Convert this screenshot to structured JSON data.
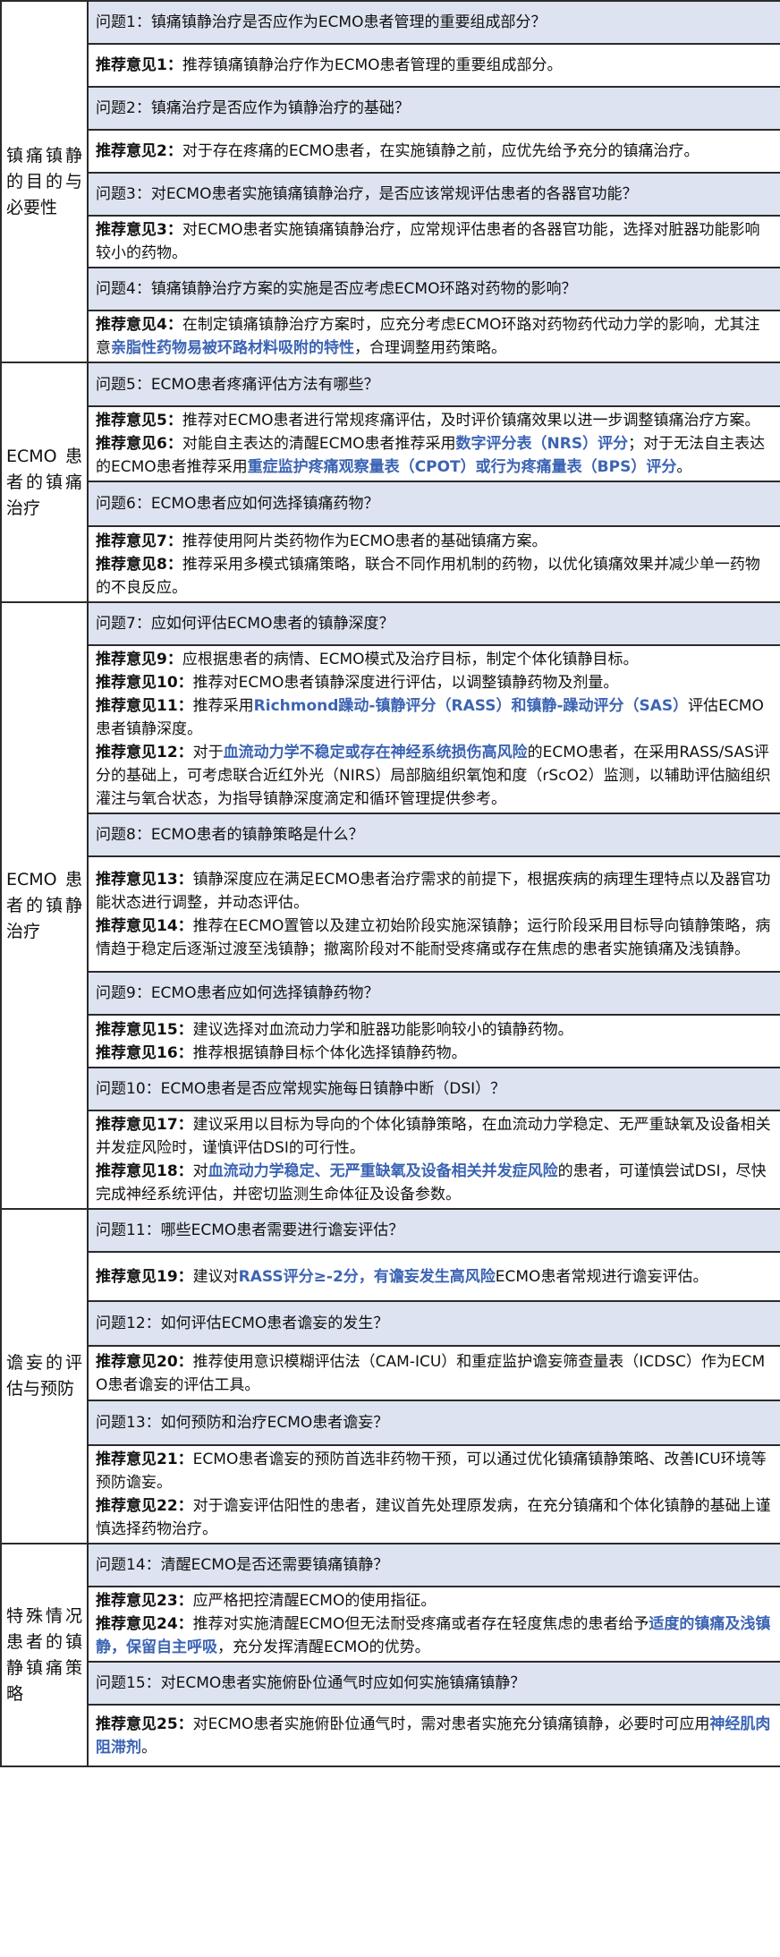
{
  "sections": [
    {
      "category": "镇痛镇静的目的与必要性",
      "qas": [
        {
          "question": "问题1：镇痛镇静治疗是否应作为ECMO患者管理的重要组成部分？",
          "recs": [
            {
              "label": "推荐意见1：",
              "parts": [
                {
                  "t": "推荐镇痛镇静治疗作为ECMO患者管理的重要组成部分。"
                }
              ]
            }
          ]
        },
        {
          "question": "问题2：镇痛治疗是否应作为镇静治疗的基础？",
          "recs": [
            {
              "label": "推荐意见2：",
              "parts": [
                {
                  "t": "对于存在疼痛的ECMO患者，在实施镇静之前，应优先给予充分的镇痛治疗。"
                }
              ]
            }
          ]
        },
        {
          "question": "问题3：对ECMO患者实施镇痛镇静治疗，是否应该常规评估患者的各器官功能？",
          "recs": [
            {
              "label": "推荐意见3：",
              "parts": [
                {
                  "t": "对ECMO患者实施镇痛镇静治疗，应常规评估患者的各器官功能，选择对脏器功能影响较小的药物。"
                }
              ]
            }
          ]
        },
        {
          "question": "问题4：镇痛镇静治疗方案的实施是否应考虑ECMO环路对药物的影响？",
          "recs": [
            {
              "label": "推荐意见4：",
              "parts": [
                {
                  "t": "在制定镇痛镇静治疗方案时，应充分考虑ECMO环路对药物药代动力学的影响，尤其注意"
                },
                {
                  "t": "亲脂性药物易被环路材料吸附的特性",
                  "hl": true
                },
                {
                  "t": "，合理调整用药策略。"
                }
              ]
            }
          ]
        }
      ]
    },
    {
      "category": "ECMO患者的镇痛治疗",
      "qas": [
        {
          "question": "问题5：ECMO患者疼痛评估方法有哪些？",
          "recs": [
            {
              "label": "推荐意见5：",
              "parts": [
                {
                  "t": "推荐对ECMO患者进行常规疼痛评估，及时评价镇痛效果以进一步调整镇痛治疗方案。"
                }
              ]
            },
            {
              "label": "推荐意见6：",
              "parts": [
                {
                  "t": "对能自主表达的清醒ECMO患者推荐采用"
                },
                {
                  "t": "数字评分表（NRS）评分",
                  "hl": true
                },
                {
                  "t": "；对于无法自主表达的ECMO患者推荐采用"
                },
                {
                  "t": "重症监护疼痛观察量表（CPOT）或行为疼痛量表（BPS）评分",
                  "hl": true
                },
                {
                  "t": "。"
                }
              ]
            }
          ]
        },
        {
          "question": "问题6：ECMO患者应如何选择镇痛药物？",
          "recs": [
            {
              "label": "推荐意见7：",
              "parts": [
                {
                  "t": "推荐使用阿片类药物作为ECMO患者的基础镇痛方案。"
                }
              ]
            },
            {
              "label": "推荐意见8：",
              "parts": [
                {
                  "t": "推荐采用多模式镇痛策略，联合不同作用机制的药物，以优化镇痛效果并减少单一药物的不良反应。"
                }
              ]
            }
          ]
        }
      ]
    },
    {
      "category": "ECMO患者的镇静治疗",
      "qas": [
        {
          "question": "问题7：应如何评估ECMO患者的镇静深度？",
          "recs": [
            {
              "label": "推荐意见9：",
              "parts": [
                {
                  "t": "应根据患者的病情、ECMO模式及治疗目标，制定个体化镇静目标。"
                }
              ]
            },
            {
              "label": "推荐意见10：",
              "parts": [
                {
                  "t": "推荐对ECMO患者镇静深度进行评估，以调整镇静药物及剂量。"
                }
              ]
            },
            {
              "label": "推荐意见11：",
              "parts": [
                {
                  "t": "推荐采用"
                },
                {
                  "t": "Richmond躁动-镇静评分（RASS）和镇静-躁动评分（SAS）",
                  "hl": true
                },
                {
                  "t": "评估ECMO患者镇静深度。"
                }
              ]
            },
            {
              "label": "推荐意见12：",
              "parts": [
                {
                  "t": "对于"
                },
                {
                  "t": "血流动力学不稳定或存在神经系统损伤高风险",
                  "hl": true
                },
                {
                  "t": "的ECMO患者，在采用RASS/SAS评分的基础上，可考虑联合近红外光（NIRS）局部脑组织氧饱和度（rScO2）监测，以辅助评估脑组织灌注与氧合状态，为指导镇静深度滴定和循环管理提供参考。"
                }
              ]
            }
          ]
        },
        {
          "question": "问题8：ECMO患者的镇静策略是什么？",
          "recs": [
            {
              "label": "推荐意见13：",
              "parts": [
                {
                  "t": "镇静深度应在满足ECMO患者治疗需求的前提下，根据疾病的病理生理特点以及器官功能状态进行调整，并动态评估。"
                }
              ]
            },
            {
              "label": "推荐意见14：",
              "parts": [
                {
                  "t": "推荐在ECMO置管以及建立初始阶段实施深镇静；运行阶段采用目标导向镇静策略，病情趋于稳定后逐渐过渡至浅镇静；撤离阶段对不能耐受疼痛或存在焦虑的患者实施镇痛及浅镇静。"
                }
              ]
            }
          ]
        },
        {
          "question": "问题9：ECMO患者应如何选择镇静药物？",
          "recs": [
            {
              "label": "推荐意见15：",
              "parts": [
                {
                  "t": "建议选择对血流动力学和脏器功能影响较小的镇静药物。"
                }
              ]
            },
            {
              "label": "推荐意见16：",
              "parts": [
                {
                  "t": "推荐根据镇静目标个体化选择镇静药物。"
                }
              ]
            }
          ]
        },
        {
          "question": "问题10：ECMO患者是否应常规实施每日镇静中断（DSI）？",
          "recs": [
            {
              "label": "推荐意见17：",
              "parts": [
                {
                  "t": "建议采用以目标为导向的个体化镇静策略，在血流动力学稳定、无严重缺氧及设备相关并发症风险时，谨慎评估DSI的可行性。"
                }
              ]
            },
            {
              "label": "推荐意见18：",
              "parts": [
                {
                  "t": "对"
                },
                {
                  "t": "血流动力学稳定、无严重缺氧及设备相关并发症风险",
                  "hl": true
                },
                {
                  "t": "的患者，可谨慎尝试DSI，尽快完成神经系统评估，并密切监测生命体征及设备参数。"
                }
              ]
            }
          ]
        }
      ]
    },
    {
      "category": "谵妄的评估与预防",
      "qas": [
        {
          "question": "问题11：哪些ECMO患者需要进行谵妄评估？",
          "recs": [
            {
              "label": "推荐意见19：",
              "parts": [
                {
                  "t": "建议对"
                },
                {
                  "t": "RASS评分≥-2分，有谵妄发生高风险",
                  "hl": true
                },
                {
                  "t": "ECMO患者常规进行谵妄评估。"
                }
              ]
            }
          ]
        },
        {
          "question": "问题12：如何评估ECMO患者谵妄的发生？",
          "recs": [
            {
              "label": "推荐意见20：",
              "parts": [
                {
                  "t": "推荐使用意识模糊评估法（CAM-ICU）和重症监护谵妄筛查量表（ICDSC）作为ECMO患者谵妄的评估工具。"
                }
              ]
            }
          ]
        },
        {
          "question": "问题13：如何预防和治疗ECMO患者谵妄？",
          "recs": [
            {
              "label": "推荐意见21：",
              "parts": [
                {
                  "t": "ECMO患者谵妄的预防首选非药物干预，可以通过优化镇痛镇静策略、改善ICU环境等预防谵妄。"
                }
              ]
            },
            {
              "label": "推荐意见22：",
              "parts": [
                {
                  "t": "对于谵妄评估阳性的患者，建议首先处理原发病，在充分镇痛和个体化镇静的基础上谨慎选择药物治疗。"
                }
              ]
            }
          ]
        }
      ]
    },
    {
      "category": "特殊情况患者的镇静镇痛策略",
      "qas": [
        {
          "question": "问题14：清醒ECMO是否还需要镇痛镇静？",
          "recs": [
            {
              "label": "推荐意见23：",
              "parts": [
                {
                  "t": "应严格把控清醒ECMO的使用指征。"
                }
              ]
            },
            {
              "label": "推荐意见24：",
              "parts": [
                {
                  "t": "推荐对实施清醒ECMO但无法耐受疼痛或者存在轻度焦虑的患者给予"
                },
                {
                  "t": "适度的镇痛及浅镇静，保留自主呼吸",
                  "hl": true
                },
                {
                  "t": "，充分发挥清醒ECMO的优势。"
                }
              ]
            }
          ]
        },
        {
          "question": "问题15：对ECMO患者实施俯卧位通气时应如何实施镇痛镇静？",
          "recs": [
            {
              "label": "推荐意见25：",
              "parts": [
                {
                  "t": "对ECMO患者实施俯卧位通气时，需对患者实施充分镇痛镇静，必要时可应用"
                },
                {
                  "t": "神经肌肉阻滞剂",
                  "hl": true
                },
                {
                  "t": "。"
                }
              ]
            }
          ]
        }
      ]
    }
  ]
}
